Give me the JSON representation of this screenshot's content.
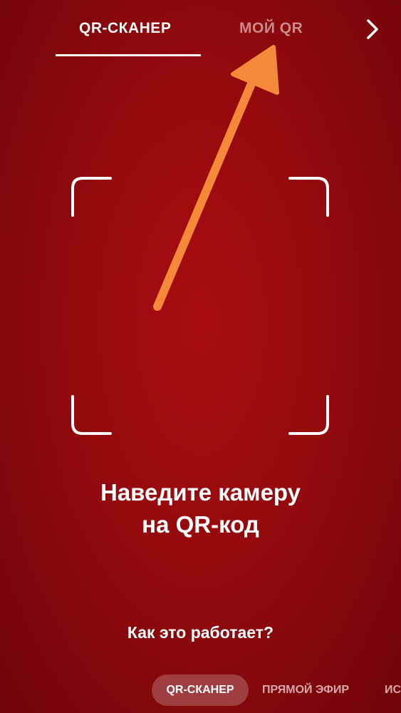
{
  "top_tabs": {
    "active_label": "QR-СКАНЕР",
    "inactive_label": "МОЙ QR",
    "next_icon": "chevron-right-icon"
  },
  "scanner": {
    "frame_icon": "scan-frame-corners",
    "pointer_icon": "orange-arrow-annotation",
    "pointer_color": "#f5893a",
    "instruction_line1": "Наведите камеру",
    "instruction_line2": "на QR-код",
    "help_link": "Как это работает?"
  },
  "mode_bar": {
    "modes": [
      {
        "label": "QR-СКАНЕР",
        "selected": true
      },
      {
        "label": "ПРЯМОЙ ЭФИР",
        "selected": false
      },
      {
        "label": "ИС",
        "selected": false
      }
    ]
  },
  "colors": {
    "background": "#930a0d",
    "text": "#ffffff",
    "inactive_tab": "#c98a8c"
  }
}
